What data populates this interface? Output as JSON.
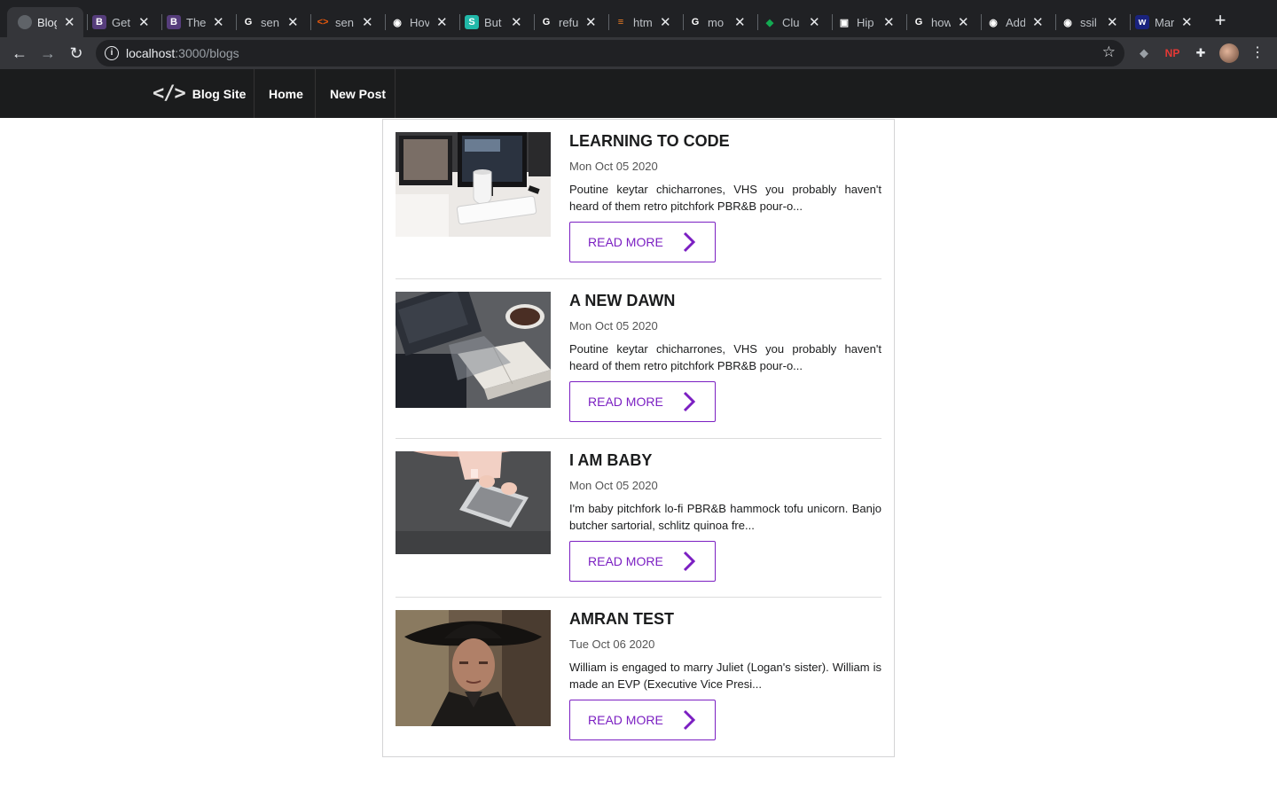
{
  "browser": {
    "tabs": [
      {
        "title": "Blog",
        "icon": "globe-icon",
        "color": "#5f6368"
      },
      {
        "title": "Get",
        "icon": "bootstrap-icon",
        "color": "#563d7c"
      },
      {
        "title": "The",
        "icon": "bootstrap-icon",
        "color": "#563d7c"
      },
      {
        "title": "sen",
        "icon": "google-icon",
        "color": "#ffffff"
      },
      {
        "title": "sen",
        "icon": "code-icon",
        "color": "#e8590c"
      },
      {
        "title": "Hov",
        "icon": "github-icon",
        "color": "#ffffff"
      },
      {
        "title": "But",
        "icon": "s-icon",
        "color": "#21b8a9"
      },
      {
        "title": "refu",
        "icon": "google-icon",
        "color": "#ffffff"
      },
      {
        "title": "htm",
        "icon": "stackoverflow-icon",
        "color": "#f48024"
      },
      {
        "title": "mo",
        "icon": "google-icon",
        "color": "#ffffff"
      },
      {
        "title": "Clu",
        "icon": "leaf-icon",
        "color": "#13aa52"
      },
      {
        "title": "Hip",
        "icon": "hipster-icon",
        "color": "#ffffff"
      },
      {
        "title": "how",
        "icon": "google-icon",
        "color": "#ffffff"
      },
      {
        "title": "Add",
        "icon": "github-icon",
        "color": "#ffffff"
      },
      {
        "title": "ssil",
        "icon": "github-icon",
        "color": "#ffffff"
      },
      {
        "title": "Mar",
        "icon": "w-icon",
        "color": "#1a237e"
      }
    ],
    "url_host": "localhost",
    "url_path": ":3000/blogs"
  },
  "site": {
    "brand": "Blog Site",
    "logo": "</>",
    "nav": {
      "home": "Home",
      "new_post": "New Post"
    }
  },
  "posts": [
    {
      "title": "LEARNING TO CODE",
      "date": "Mon Oct 05 2020",
      "excerpt": "Poutine keytar chicharrones, VHS you probably haven't heard of them retro pitchfork PBR&B pour-o...",
      "button": "READ MORE",
      "image": "desk-computer-image"
    },
    {
      "title": "A NEW DAWN",
      "date": "Mon Oct 05 2020",
      "excerpt": "Poutine keytar chicharrones, VHS you probably haven't heard of them retro pitchfork PBR&B pour-o...",
      "button": "READ MORE",
      "image": "notebook-coffee-image"
    },
    {
      "title": "I AM BABY",
      "date": "Mon Oct 05 2020",
      "excerpt": "I'm baby pitchfork lo-fi PBR&B hammock tofu unicorn. Banjo butcher sartorial, schlitz quinoa fre...",
      "button": "READ MORE",
      "image": "laptop-lap-image"
    },
    {
      "title": "AMRAN TEST",
      "date": "Tue Oct 06 2020",
      "excerpt": "William is engaged to marry Juliet (Logan's sister). William is made an EVP (Executive Vice Presi...",
      "button": "READ MORE",
      "image": "man-in-black-hat-image"
    }
  ],
  "colors": {
    "accent": "#7b1fc2",
    "nav_bg": "#1b1c1d"
  }
}
